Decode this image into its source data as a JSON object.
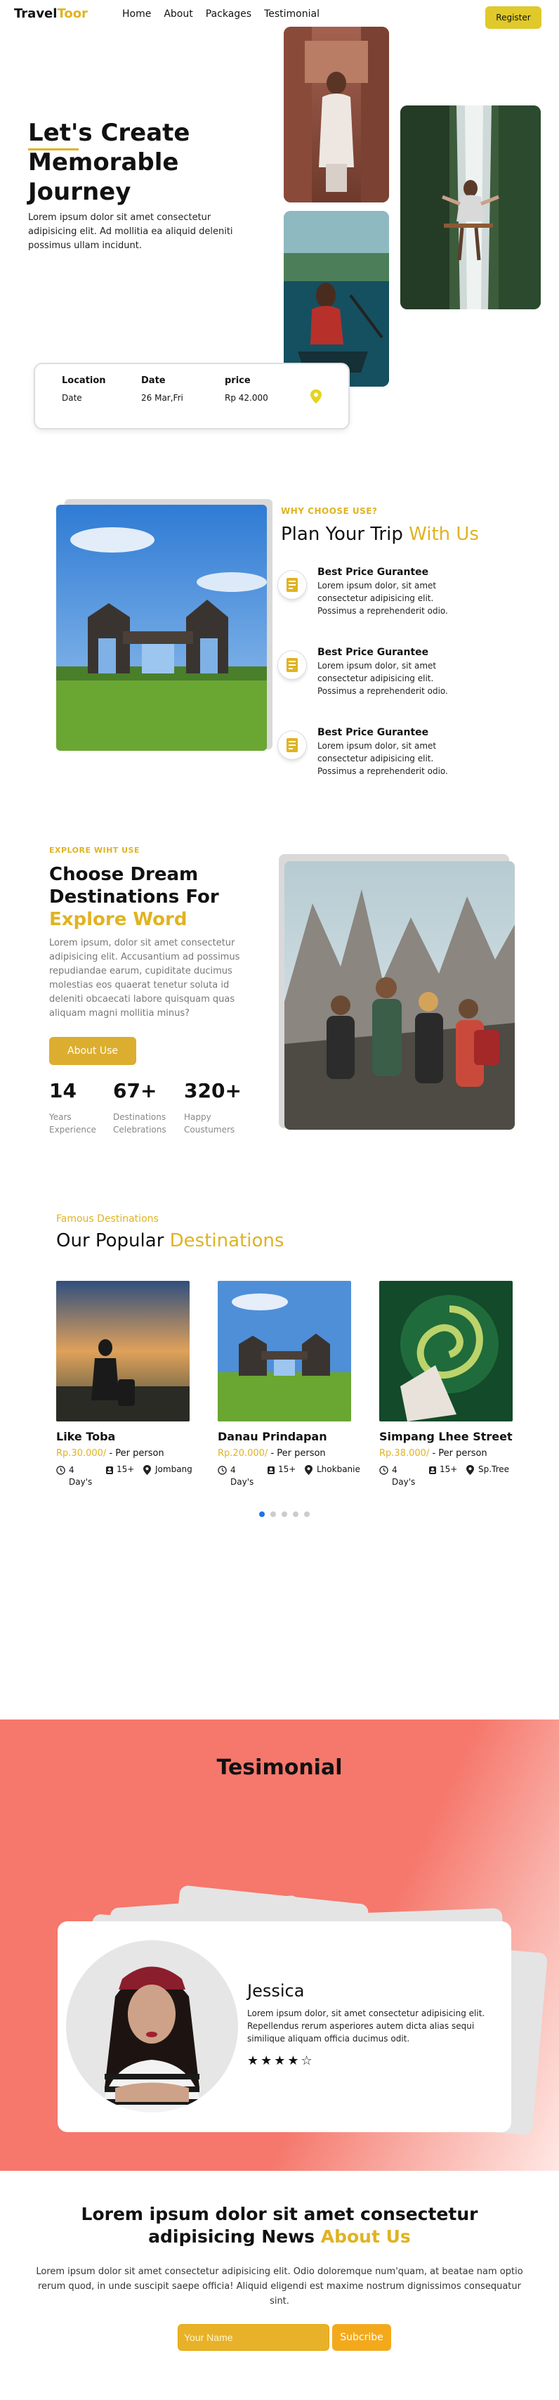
{
  "nav": {
    "logo_part1": "Travel",
    "logo_part2": "Toor",
    "links": [
      "Home",
      "About",
      "Packages",
      "Testimonial"
    ],
    "register": "Register"
  },
  "hero": {
    "title": "Let's Create Memorable Journey",
    "description": "Lorem ipsum dolor sit amet consectetur adipisicing elit. Ad mollitia ea aliquid deleniti possimus ullam incidunt."
  },
  "booking": {
    "location_label": "Location",
    "location_value": "Date",
    "date_label": "Date",
    "date_value": "26 Mar,Fri",
    "price_label": "price",
    "price_value": "Rp 42.000"
  },
  "why": {
    "kicker": "WHY CHOOSE USE?",
    "title_part1": "Plan Your Trip",
    "title_part2": "With Us",
    "features": [
      {
        "title": "Best Price Gurantee",
        "desc": "Lorem ipsum dolor, sit amet consectetur adipisicing elit. Possimus a reprehenderit odio."
      },
      {
        "title": "Best Price Gurantee",
        "desc": "Lorem ipsum dolor, sit amet consectetur adipisicing elit. Possimus a reprehenderit odio."
      },
      {
        "title": "Best Price Gurantee",
        "desc": "Lorem ipsum dolor, sit amet consectetur adipisicing elit. Possimus a reprehenderit odio."
      }
    ]
  },
  "choose": {
    "kicker": "EXPLORE WIHT USE",
    "title_part1": "Choose Dream Destinations For",
    "title_part2": "Explore Word",
    "description": "Lorem ipsum, dolor sit amet consectetur adipisicing elit. Accusantium ad possimus repudiandae earum, cupiditate ducimus molestias eos quaerat tenetur soluta id deleniti obcaecati labore quisquam quas aliquam magni mollitia minus?",
    "button": "About Use",
    "stats": [
      {
        "number": "14",
        "label1": "Years",
        "label2": "Experience"
      },
      {
        "number": "67+",
        "label1": "Destinations",
        "label2": "Celebrations"
      },
      {
        "number": "320+",
        "label1": "Happy",
        "label2": "Coustumers"
      }
    ]
  },
  "popular": {
    "kicker": "Famous Destinations",
    "title_part1": "Our Popular",
    "title_part2": "Destinations",
    "per": "- Per person",
    "destinations": [
      {
        "name": "Like Toba",
        "price": "Rp.30.000/",
        "days": "4 Day's",
        "people": "15+",
        "place": "Jombang"
      },
      {
        "name": "Danau Prindapan",
        "price": "Rp.20.000/",
        "days": "4 Day's",
        "people": "15+",
        "place": "Lhokbanie"
      },
      {
        "name": "Simpang Lhee Street",
        "price": "Rp.38.000/",
        "days": "4 Day's",
        "people": "15+",
        "place": "Sp.Tree"
      }
    ]
  },
  "testimonial": {
    "title": "Tesimonial",
    "name": "Jessica",
    "text": "Lorem ipsum dolor, sit amet consectetur adipisicing elit. Repellendus rerum asperiores autem dicta alias sequi similique aliquam officia ducimus odit.",
    "stars": "★★★★☆"
  },
  "news": {
    "title_part1": "Lorem ipsum dolor sit amet consectetur adipisicing News",
    "title_part2": "About Us",
    "description": "Lorem ipsum dolor sit amet consectetur adipisicing elit. Odio doloremque num'quam, at beatae nam optio rerum quod, in unde suscipit saepe officia! Aliquid eligendi est maxime nostrum dignissimos consequatur sint.",
    "placeholder": "Your Name",
    "button": "Subcribe"
  },
  "colors": {
    "accent": "#e0b321",
    "testimonial_bg": "#f6776b",
    "dot_active": "#1e73e8"
  }
}
